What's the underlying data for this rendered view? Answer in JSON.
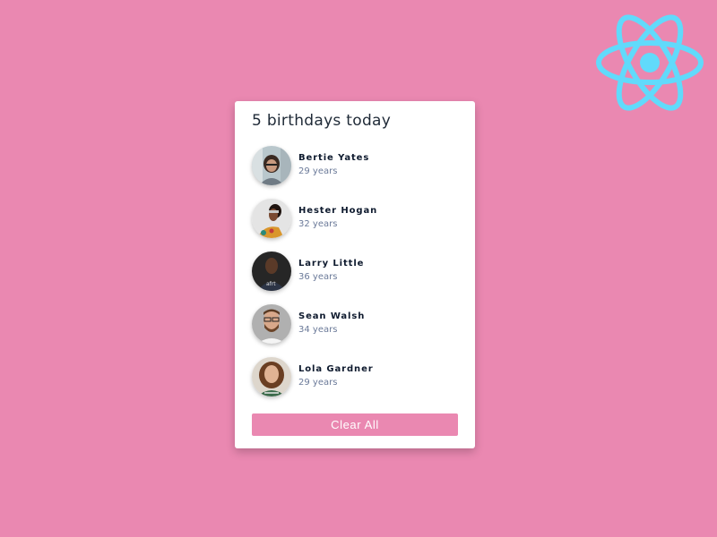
{
  "background_color": "#ea88b1",
  "logo": {
    "icon": "react-logo-icon",
    "color": "#61dafb"
  },
  "card": {
    "title": "5 birthdays today",
    "people": [
      {
        "name": "Bertie Yates",
        "age": "29 years",
        "avatar": "photo-woman-glasses"
      },
      {
        "name": "Hester Hogan",
        "age": "32 years",
        "avatar": "photo-woman-sunglasses"
      },
      {
        "name": "Larry Little",
        "age": "36 years",
        "avatar": "photo-man-dark"
      },
      {
        "name": "Sean Walsh",
        "age": "34 years",
        "avatar": "photo-man-glasses-beard"
      },
      {
        "name": "Lola Gardner",
        "age": "29 years",
        "avatar": "photo-woman-curly-hair"
      }
    ],
    "clear_button_label": "Clear All"
  }
}
